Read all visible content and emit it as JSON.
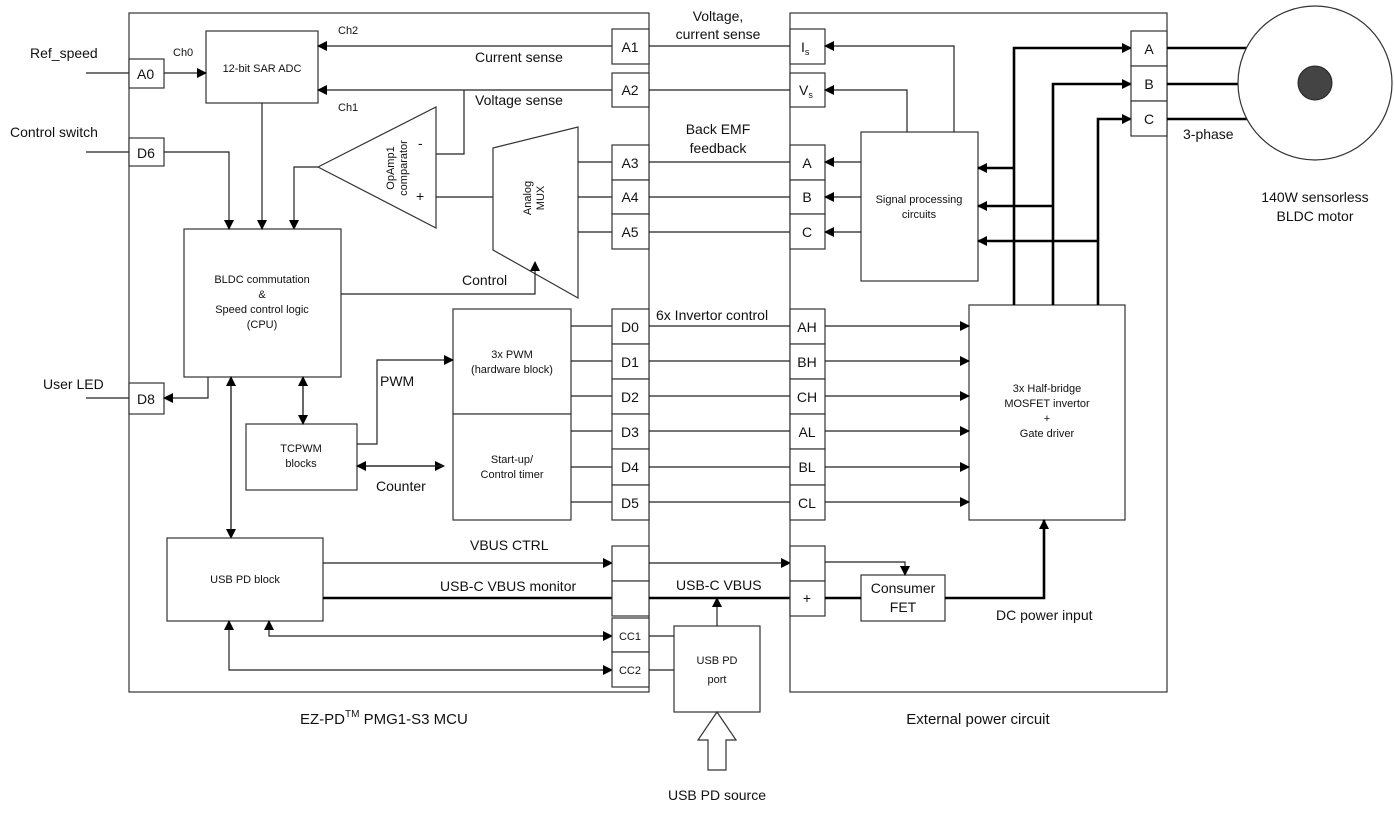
{
  "mcu": {
    "title_prefix": "EZ-PD",
    "title_tm": "TM",
    "title_suffix": " PMG1-S3 MCU"
  },
  "external": {
    "title": "External power circuit"
  },
  "inputs": {
    "ref_speed": "Ref_speed",
    "control_switch": "Control switch",
    "user_led": "User LED"
  },
  "pins_left": {
    "a0": "A0",
    "d6": "D6",
    "d8": "D8"
  },
  "pins_mcu": [
    "A1",
    "A2",
    "A3",
    "A4",
    "A5",
    "D0",
    "D1",
    "D2",
    "D3",
    "D4",
    "D5",
    "CC1",
    "CC2"
  ],
  "pins_ext": {
    "is": "I",
    "is_sub": "s",
    "vs": "V",
    "vs_sub": "s",
    "a": "A",
    "b": "B",
    "c": "C",
    "gate": [
      "AH",
      "BH",
      "CH",
      "AL",
      "BL",
      "CL"
    ],
    "plus": "+"
  },
  "motor_pins": [
    "A",
    "B",
    "C"
  ],
  "blocks": {
    "adc": "12-bit SAR ADC",
    "opamp": [
      "OpAmp1",
      "comparator"
    ],
    "opamp_minus": "-",
    "opamp_plus": "+",
    "mux": [
      "Analog",
      "MUX"
    ],
    "bldc": [
      "BLDC commutation",
      "&",
      "Speed control logic",
      "(CPU)"
    ],
    "pwm": [
      "3x PWM",
      "(hardware block)"
    ],
    "startup": [
      "Start-up/",
      "Control timer"
    ],
    "tcpwm": [
      "TCPWM",
      "blocks"
    ],
    "usbpd": "USB PD block",
    "usbpd_port": [
      "USB PD",
      "port"
    ],
    "signal": [
      "Signal processing",
      "circuits"
    ],
    "halfbridge": [
      "3x Half-bridge",
      "MOSFET invertor",
      "+",
      "Gate driver"
    ],
    "fet": [
      "Consumer",
      "FET"
    ]
  },
  "labels": {
    "ch0": "Ch0",
    "ch1": "Ch1",
    "ch2": "Ch2",
    "current_sense": "Current sense",
    "voltage_sense": "Voltage sense",
    "vc_sense": [
      "Voltage,",
      "current sense"
    ],
    "bemf": [
      "Back EMF",
      "feedback"
    ],
    "control": "Control",
    "pwm": "PWM",
    "counter": "Counter",
    "inv_control": "6x Invertor control",
    "vbus_ctrl": "VBUS CTRL",
    "vbus_monitor": "USB-C VBUS monitor",
    "vbus": "USB-C VBUS",
    "dc_input": "DC power input",
    "three_phase": "3-phase",
    "motor": [
      "140W sensorless",
      "BLDC motor"
    ],
    "source": "USB PD source"
  }
}
